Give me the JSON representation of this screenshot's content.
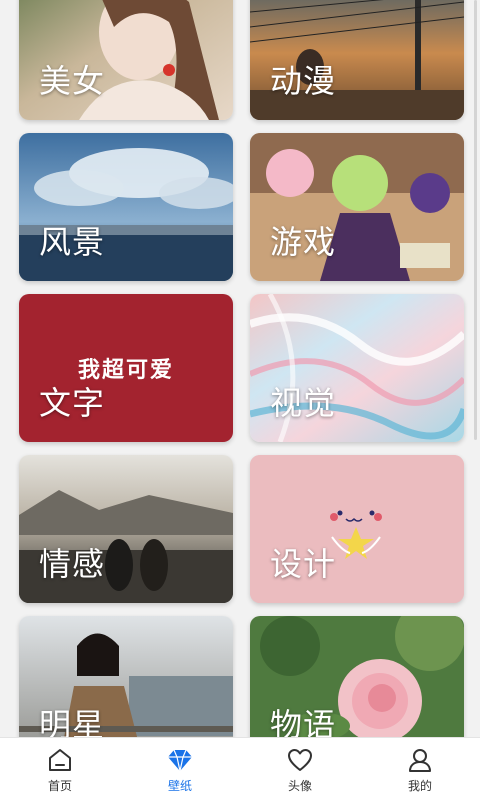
{
  "categories": [
    {
      "id": "beauty",
      "label": "美女"
    },
    {
      "id": "anime",
      "label": "动漫"
    },
    {
      "id": "scenery",
      "label": "风景"
    },
    {
      "id": "game",
      "label": "游戏"
    },
    {
      "id": "text",
      "label": "文字",
      "caption": "我超可爱"
    },
    {
      "id": "visual",
      "label": "视觉"
    },
    {
      "id": "emotion",
      "label": "情感"
    },
    {
      "id": "design",
      "label": "设计"
    },
    {
      "id": "star",
      "label": "明星"
    },
    {
      "id": "story",
      "label": "物语"
    }
  ],
  "bottom_nav": {
    "items": [
      {
        "label": "首页",
        "icon": "home-icon",
        "active": false
      },
      {
        "label": "壁纸",
        "icon": "diamond-icon",
        "active": true
      },
      {
        "label": "头像",
        "icon": "heart-icon",
        "active": false
      },
      {
        "label": "我的",
        "icon": "user-icon",
        "active": false
      }
    ]
  },
  "colors": {
    "accent": "#1a73e8",
    "text_card_bg": "#a3232f",
    "design_card_bg": "#ebbcbf",
    "page_bg": "#f2f2f2"
  }
}
